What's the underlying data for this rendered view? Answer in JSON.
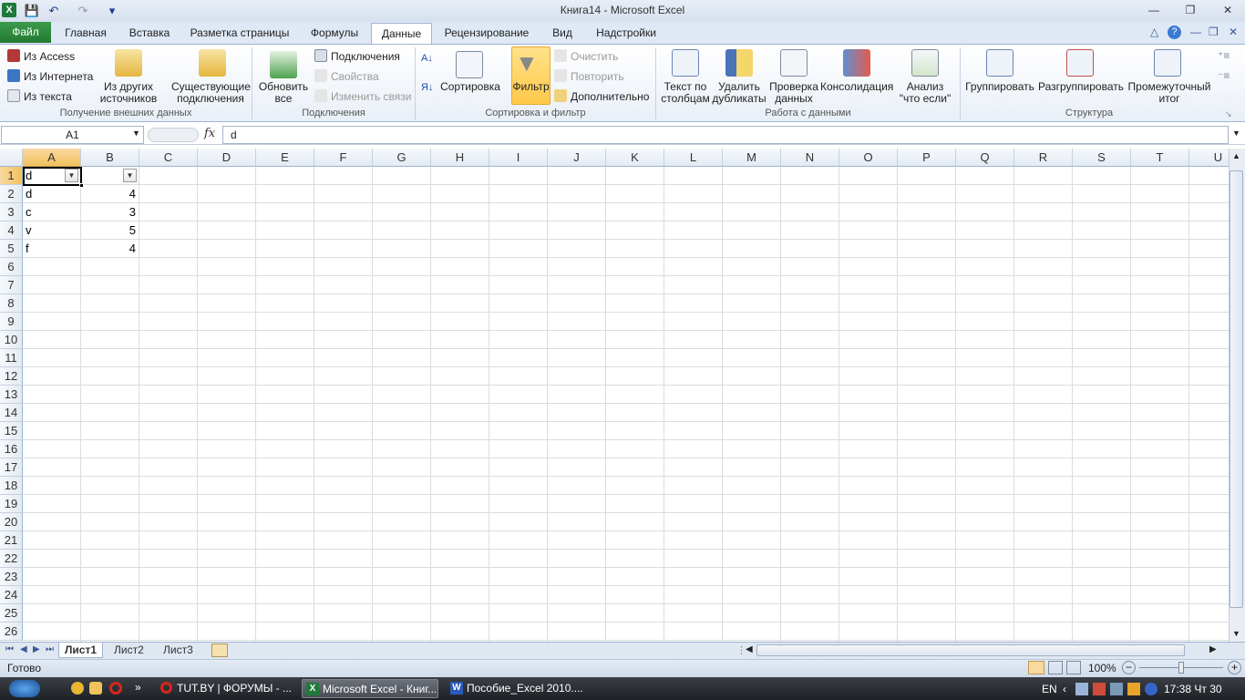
{
  "window": {
    "title": "Книга14  -  Microsoft Excel",
    "app_icon": "X"
  },
  "qat": {
    "save": "💾",
    "undo": "↶",
    "redo": "↷",
    "customize": "▾"
  },
  "tabs": {
    "file": "Файл",
    "items": [
      "Главная",
      "Вставка",
      "Разметка страницы",
      "Формулы",
      "Данные",
      "Рецензирование",
      "Вид",
      "Надстройки"
    ],
    "active": "Данные"
  },
  "ribbon": {
    "ext": {
      "access": "Из Access",
      "web": "Из Интернета",
      "text": "Из текста",
      "other": "Из других источников",
      "existing": "Существующие подключения",
      "label": "Получение внешних данных"
    },
    "conn": {
      "refresh": "Обновить все",
      "connections": "Подключения",
      "props": "Свойства",
      "edit_links": "Изменить связи",
      "label": "Подключения"
    },
    "sort": {
      "sort": "Сортировка",
      "filter": "Фильтр",
      "clear": "Очистить",
      "reapply": "Повторить",
      "advanced": "Дополнительно",
      "label": "Сортировка и фильтр"
    },
    "tools": {
      "text_to_cols": "Текст по столбцам",
      "remove_dups": "Удалить дубликаты",
      "validation": "Проверка данных",
      "consolidate": "Консолидация",
      "whatif": "Анализ \"что если\"",
      "label": "Работа с данными"
    },
    "outline": {
      "group": "Группировать",
      "ungroup": "Разгруппировать",
      "subtotal": "Промежуточный итог",
      "label": "Структура"
    }
  },
  "formula": {
    "name_box": "A1",
    "fx": "fx",
    "content": "d"
  },
  "columns": [
    "A",
    "B",
    "C",
    "D",
    "E",
    "F",
    "G",
    "H",
    "I",
    "J",
    "K",
    "L",
    "M",
    "N",
    "O",
    "P",
    "Q",
    "R",
    "S",
    "T",
    "U"
  ],
  "rows": [
    "1",
    "2",
    "3",
    "4",
    "5",
    "6",
    "7",
    "8",
    "9",
    "10",
    "11",
    "12",
    "13",
    "14",
    "15",
    "16",
    "17",
    "18",
    "19",
    "20",
    "21",
    "22",
    "23",
    "24",
    "25",
    "26"
  ],
  "cells": {
    "A1": "d",
    "A2": "d",
    "A3": "c",
    "A4": "v",
    "A5": "f",
    "B2": "4",
    "B3": "3",
    "B4": "5",
    "B5": "4"
  },
  "sheets": {
    "tabs": [
      "Лист1",
      "Лист2",
      "Лист3"
    ],
    "active": "Лист1"
  },
  "status": {
    "ready": "Готово",
    "zoom": "100%"
  },
  "taskbar": {
    "tasks": [
      "TUT.BY | ФОРУМЫ - ...",
      "Microsoft Excel - Книг...",
      "Пособие_Excel 2010...."
    ],
    "lang": "EN",
    "clock": "17:38 Чт 30"
  }
}
